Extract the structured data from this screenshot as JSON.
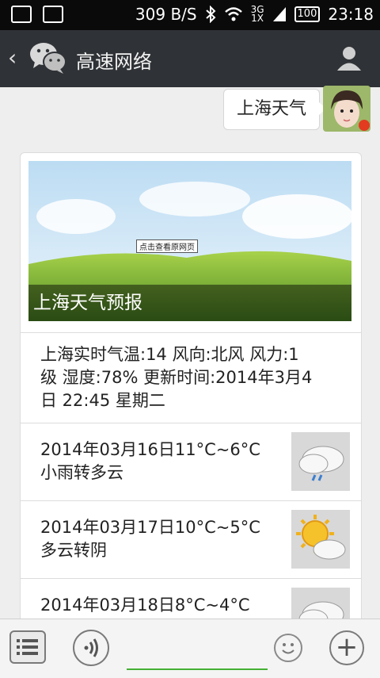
{
  "status": {
    "net_speed": "309 B/S",
    "net_type_top": "3G",
    "net_type_bottom": "1X",
    "battery": "100",
    "time": "23:18"
  },
  "nav": {
    "back_glyph": "‹",
    "title": "高速网络"
  },
  "message": {
    "text": "上海天气"
  },
  "card": {
    "banner_tip": "点击查看原网页",
    "banner_caption": "上海天气预报",
    "info": "上海实时气温:14 风向:北风 风力:1级 湿度:78% 更新时间:2014年3月4日 22:45 星期二",
    "forecast": [
      {
        "line1": "2014年03月16日11°C~6°C",
        "line2": "小雨转多云",
        "icon": "rain-cloud-icon"
      },
      {
        "line1": "2014年03月17日10°C~5°C",
        "line2": "多云转阴",
        "icon": "sun-cloud-icon"
      },
      {
        "line1": "2014年03月18日8°C~4°C",
        "line2": "",
        "icon": "cloud-icon"
      }
    ]
  },
  "bottom": {
    "plus": "+"
  },
  "colors": {
    "navbar": "#2f3236",
    "input_underline": "#45b035"
  }
}
